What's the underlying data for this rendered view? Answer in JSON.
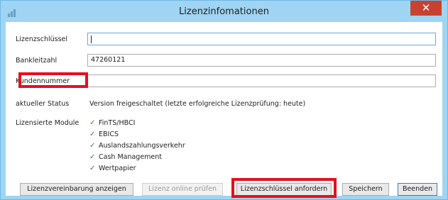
{
  "window": {
    "title": "Lizenzinfomationen",
    "close_glyph": "✕",
    "app_icon": "bar-chart-icon"
  },
  "form": {
    "license_key": {
      "label": "Lizenzschlüssel",
      "value": ""
    },
    "bank_code": {
      "label": "Bankleitzahl",
      "value": "47260121"
    },
    "customer_number": {
      "label": "Kundennummer",
      "value": ""
    },
    "status": {
      "label": "aktueller Status",
      "value": "Version freigeschaltet (letzte erfolgreiche Lizenzprüfung: heute)"
    },
    "modules": {
      "label": "Lizensierte Module",
      "check_glyph": "✓",
      "items": [
        "FinTS/HBCI",
        "EBICS",
        "Auslandszahlungsverkehr",
        "Cash Management",
        "Wertpapier"
      ]
    }
  },
  "buttons": {
    "show_agreement": "Lizenzvereinbarung anzeigen",
    "check_online": "Lizenz online prüfen",
    "request_key": "Lizenzschlüssel anfordern",
    "save": "Speichern",
    "exit": "Beenden"
  },
  "colors": {
    "titlebar": "#9fd4f2",
    "highlight": "#e5101a",
    "close": "#c7432f",
    "check": "#2c8a2c"
  }
}
